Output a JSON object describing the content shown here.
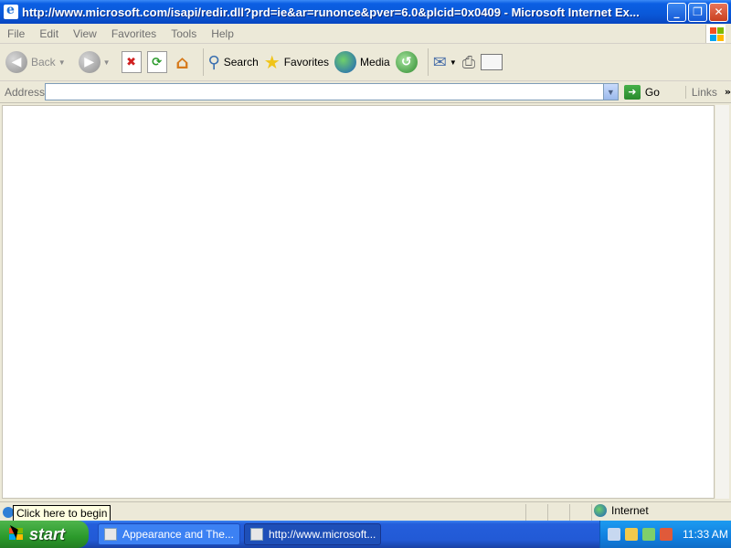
{
  "window": {
    "title": "http://www.microsoft.com/isapi/redir.dll?prd=ie&ar=runonce&pver=6.0&plcid=0x0409 - Microsoft Internet Ex..."
  },
  "menu": [
    "File",
    "Edit",
    "View",
    "Favorites",
    "Tools",
    "Help"
  ],
  "toolbar": {
    "back": "Back",
    "search": "Search",
    "favorites": "Favorites",
    "media": "Media"
  },
  "address": {
    "label": "Address",
    "value": "",
    "go": "Go",
    "links": "Links"
  },
  "status": {
    "tooltip": "Click here to begin",
    "zone": "Internet"
  },
  "taskbar": {
    "start": "start",
    "tasks": [
      "Appearance and The...",
      "http://www.microsoft..."
    ],
    "clock": "11:33 AM"
  }
}
